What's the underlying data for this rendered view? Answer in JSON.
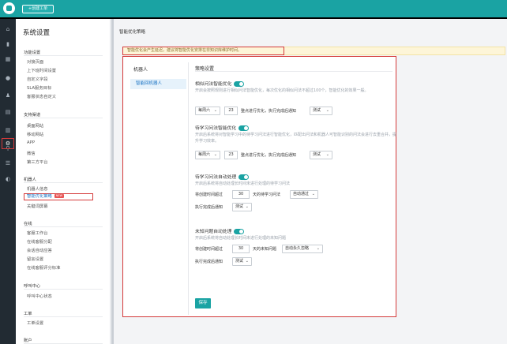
{
  "topbar": {
    "create_label": "+创建工单"
  },
  "nav": {
    "title": "系统设置",
    "sections": [
      {
        "title": "功能设置",
        "items": [
          "对接页面",
          "上下班时间设置",
          "自定义字段",
          "SLA服务目标",
          "客服状态自定义"
        ]
      },
      {
        "title": "支持渠道",
        "items": [
          "桌面网站",
          "移动网站",
          "APP",
          "微信",
          "第三方平台"
        ]
      },
      {
        "title": "机器人",
        "items": [
          "机器人信息",
          "智能优化策略",
          "关键词屏幕"
        ]
      },
      {
        "title": "在线",
        "items": [
          "客服工作台",
          "在线客服分配",
          "会话自动应答",
          "留言设置",
          "在线客服评分标准"
        ]
      },
      {
        "title": "呼叫中心",
        "items": [
          "呼叫中心状态"
        ]
      },
      {
        "title": "工单",
        "items": [
          "工单设置"
        ]
      },
      {
        "title": "账户",
        "items": []
      }
    ],
    "new_badge": "NEW"
  },
  "main": {
    "page_title": "智能优化策略",
    "notice": "智能优化会产生延迟，建议将智能优化安排在非知识库维护时间。",
    "inner_nav": {
      "title": "机器人",
      "item": "智能回机器人"
    },
    "strategy_title": "策略设置",
    "blocks": [
      {
        "title": "相似问法智能优化",
        "desc": "开启会按照规则进行相似问法智能优化，每次优化的相似问法不超过100个，智能优化的效果一般。",
        "freq": "每周六",
        "num": "23",
        "mid": "整点进行优化，执行完成后通知",
        "notify": "测试"
      },
      {
        "title": "待学习问法智能优化",
        "desc": "开启后系统将对智能学习中的待学习问法进行智能优化，匹配出问法和机器人可智能识别的问法会进行去重合并，提升学习效率。",
        "freq": "每周六",
        "num": "23",
        "mid": "整点进行优化，执行完成后通知",
        "notify": "测试"
      },
      {
        "title": "待学习问法自动处理",
        "desc": "开启后系统将自动处理长时间未进行处理的待学习问法",
        "pre": "将创建时间超过",
        "num": "30",
        "mid": "天的待学习问法",
        "action": "自动通过",
        "notify_pre": "执行完成后通知",
        "notify": "测试"
      },
      {
        "title": "未知问题自动处理",
        "desc": "开启后系统将自动处理长时间未进行处理的未知问题",
        "pre": "将创建时间超过",
        "num": "30",
        "mid": "天的未知问题",
        "action": "自动永久忽略",
        "notify_pre": "执行完成后通知",
        "notify": "测试"
      }
    ],
    "save_label": "保存"
  },
  "colors": {
    "accent": "#1aa3a3",
    "highlight": "#d43a3a",
    "link": "#1a73c4"
  }
}
